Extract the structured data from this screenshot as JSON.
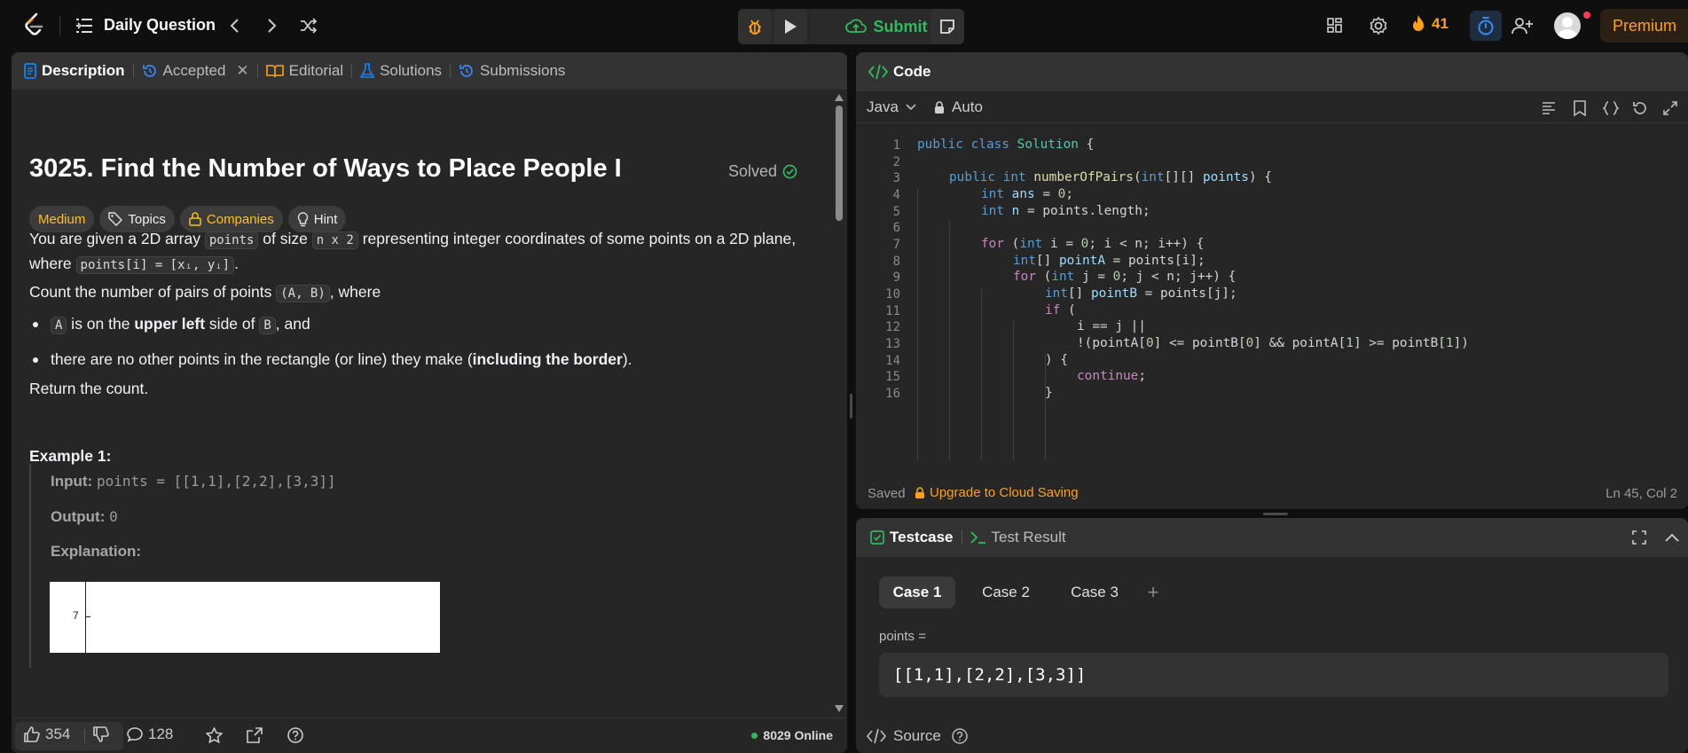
{
  "topbar": {
    "title": "Daily Question",
    "submit_label": "Submit",
    "streak_count": "41",
    "premium_label": "Premium"
  },
  "left_tabs": [
    {
      "label": "Description"
    },
    {
      "label": "Accepted"
    },
    {
      "label": "Editorial"
    },
    {
      "label": "Solutions"
    },
    {
      "label": "Submissions"
    }
  ],
  "problem": {
    "title": "3025. Find the Number of Ways to Place People I",
    "status": "Solved",
    "difficulty": "Medium",
    "chips": {
      "topics": "Topics",
      "companies": "Companies",
      "hint": "Hint"
    },
    "p1_a": "You are given a 2D array ",
    "p1_code1": "points",
    "p1_b": " of size ",
    "p1_code2": "n x 2",
    "p1_c": " representing integer coordinates of some points on a 2D plane,",
    "p1_d": "where ",
    "p1_code3": "points[i] = [xᵢ, yᵢ]",
    "p1_e": ".",
    "p2_a": "Count the number of pairs of points ",
    "p2_code": "(A, B)",
    "p2_b": ", where",
    "b1_code1": "A",
    "b1_a": " is on the ",
    "b1_bold": "upper left",
    "b1_b": " side of ",
    "b1_code2": "B",
    "b1_c": ", and",
    "b2_a": "there are no other points in the rectangle (or line) they make (",
    "b2_bold": "including the border",
    "b2_b": ").",
    "p3": "Return the count.",
    "example_title": "Example 1:",
    "input_label": "Input:",
    "input_value": "points = [[1,1],[2,2],[3,3]]",
    "output_label": "Output:",
    "output_value": "0",
    "explanation_label": "Explanation:",
    "figure_tick": "7"
  },
  "left_footer": {
    "likes": "354",
    "comments": "128",
    "online": "8029 Online"
  },
  "code_panel": {
    "title": "Code",
    "language": "Java",
    "mode": "Auto",
    "saved": "Saved",
    "upgrade": "Upgrade to Cloud Saving",
    "cursor": "Ln 45, Col 2",
    "line_numbers": [
      "1",
      "2",
      "3",
      "4",
      "5",
      "6",
      "7",
      "8",
      "9",
      "10",
      "11",
      "12",
      "13",
      "14",
      "15",
      "16"
    ]
  },
  "tests": {
    "tab_testcase": "Testcase",
    "tab_result": "Test Result",
    "cases": [
      "Case 1",
      "Case 2",
      "Case 3"
    ],
    "add": "+",
    "param_label": "points =",
    "param_value": "[[1,1],[2,2],[3,3]]",
    "source": "Source"
  },
  "colors": {
    "accent_orange": "#ffa116",
    "submit_green": "#2cbb5d",
    "medium_yellow": "#ffc01e",
    "tab_blue": "#0a84ff"
  }
}
